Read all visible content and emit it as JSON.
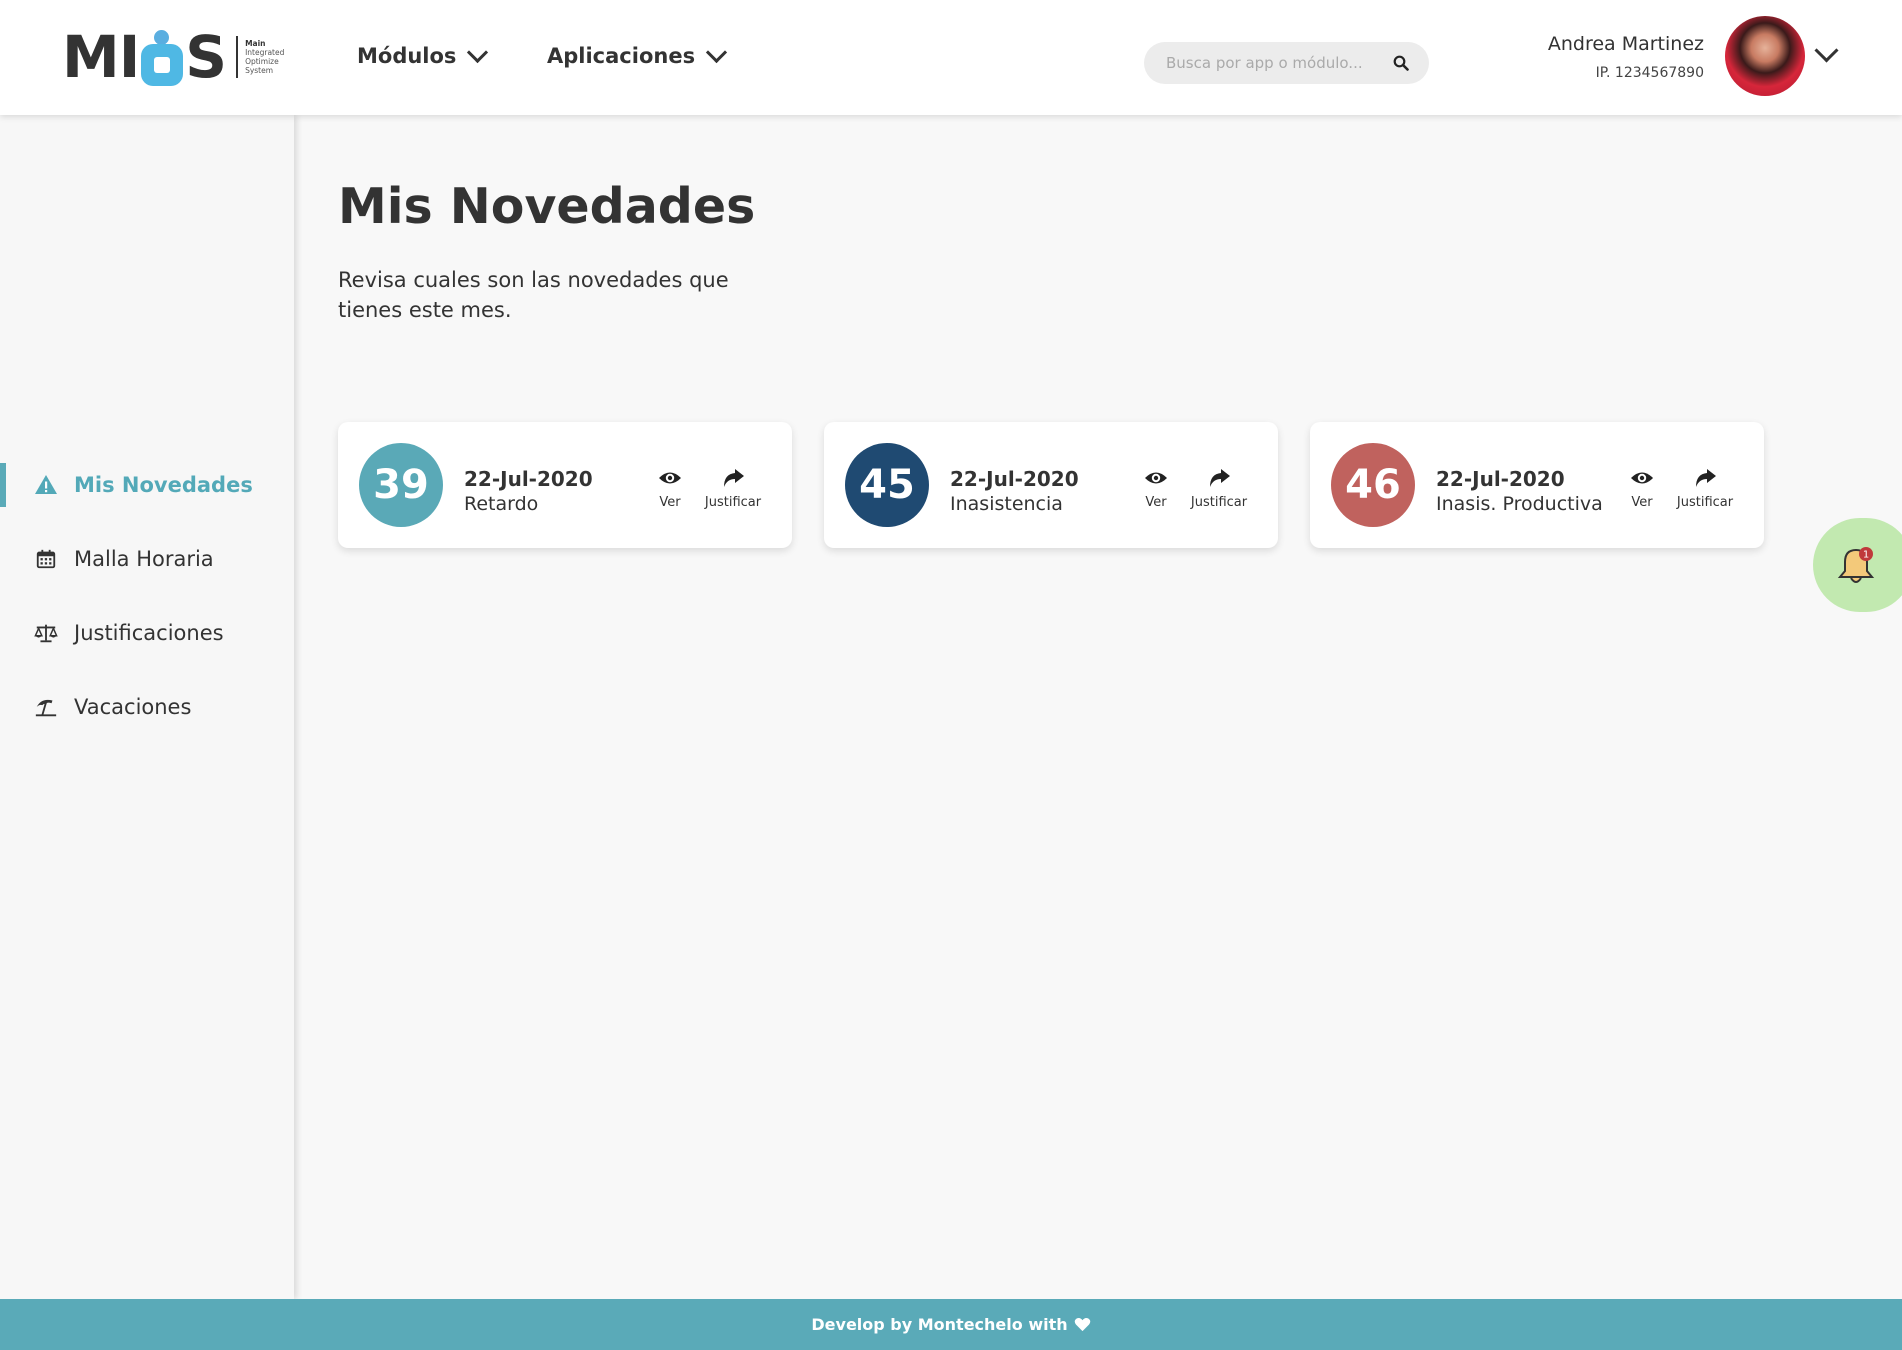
{
  "header": {
    "logo": {
      "text": "MIOS",
      "subtitle_lines": [
        "Main",
        "Integrated",
        "Optimize",
        "System"
      ]
    },
    "nav": [
      {
        "label": "Módulos",
        "icon": "chevron-down-icon"
      },
      {
        "label": "Aplicaciones",
        "icon": "chevron-down-icon"
      }
    ],
    "search": {
      "placeholder": "Busca por app o módulo...",
      "value": "",
      "icon": "search-icon"
    },
    "user": {
      "name": "Andrea Martinez",
      "ip": "IP. 1234567890",
      "avatar": "user-avatar"
    }
  },
  "sidebar": {
    "items": [
      {
        "label": "Mis Novedades",
        "icon": "warning-icon",
        "active": true
      },
      {
        "label": "Malla Horaria",
        "icon": "calendar-icon",
        "active": false
      },
      {
        "label": "Justificaciones",
        "icon": "scale-icon",
        "active": false
      },
      {
        "label": "Vacaciones",
        "icon": "beach-umbrella-icon",
        "active": false
      }
    ]
  },
  "main": {
    "title": "Mis Novedades",
    "description": "Revisa cuales son las novedades que tienes este mes.",
    "cards": [
      {
        "number": "39",
        "date": "22-Jul-2020",
        "type": "Retardo",
        "color": "#5aa9b7",
        "view_label": "Ver",
        "justify_label": "Justificar"
      },
      {
        "number": "45",
        "date": "22-Jul-2020",
        "type": "Inasistencia",
        "color": "#1f4a72",
        "view_label": "Ver",
        "justify_label": "Justificar"
      },
      {
        "number": "46",
        "date": "22-Jul-2020",
        "type": "Inasis. Productiva",
        "color": "#c0625e",
        "view_label": "Ver",
        "justify_label": "Justificar"
      }
    ]
  },
  "notification": {
    "icon": "bell-icon",
    "count": "1",
    "color": "#c2e9b0"
  },
  "footer": {
    "text": "Develop by Montechelo with",
    "icon": "heart-icon"
  },
  "colors": {
    "accent": "#5aaab8",
    "text": "#333333",
    "background": "#f8f8f8"
  }
}
